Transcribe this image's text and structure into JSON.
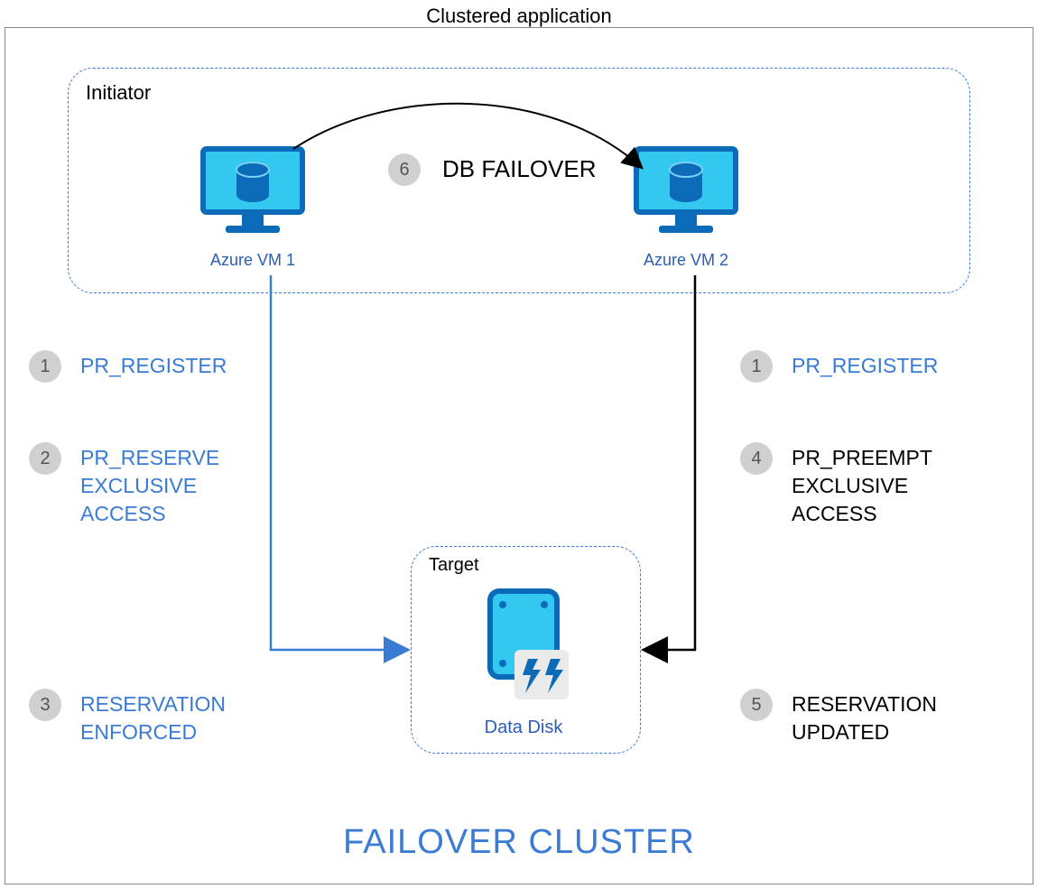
{
  "title": "Clustered application",
  "initiator": {
    "label": "Initiator",
    "vm1": "Azure VM 1",
    "vm2": "Azure VM 2"
  },
  "failover": {
    "badge": "6",
    "label": "DB FAILOVER"
  },
  "target": {
    "label": "Target",
    "disk": "Data Disk"
  },
  "left_steps": {
    "s1": {
      "num": "1",
      "text": "PR_REGISTER"
    },
    "s2": {
      "num": "2",
      "text": "PR_RESERVE\nEXCLUSIVE\nACCESS"
    },
    "s3": {
      "num": "3",
      "text": "RESERVATION\nENFORCED"
    }
  },
  "right_steps": {
    "s1": {
      "num": "1",
      "text": "PR_REGISTER"
    },
    "s4": {
      "num": "4",
      "text": "PR_PREEMPT\nEXCLUSIVE\nACCESS"
    },
    "s5": {
      "num": "5",
      "text": "RESERVATION\nUPDATED"
    }
  },
  "footer": "FAILOVER CLUSTER",
  "colors": {
    "azure_blue": "#3a7bd5",
    "azure_cyan": "#32c8f0",
    "dark_blue": "#0b6bb8"
  }
}
